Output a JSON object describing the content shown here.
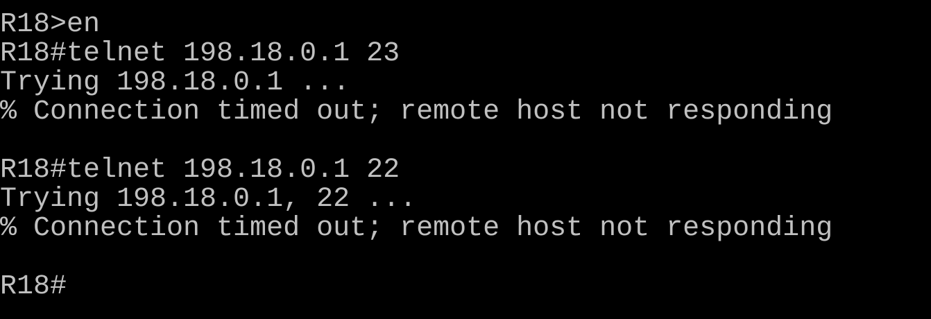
{
  "terminal": {
    "lines": [
      "R18>en",
      "R18#telnet 198.18.0.1 23",
      "Trying 198.18.0.1 ...",
      "% Connection timed out; remote host not responding",
      "",
      "R18#telnet 198.18.0.1 22",
      "Trying 198.18.0.1, 22 ...",
      "% Connection timed out; remote host not responding",
      "",
      "R18#"
    ],
    "colors": {
      "background": "#000000",
      "text": "#c0c0c0"
    }
  }
}
